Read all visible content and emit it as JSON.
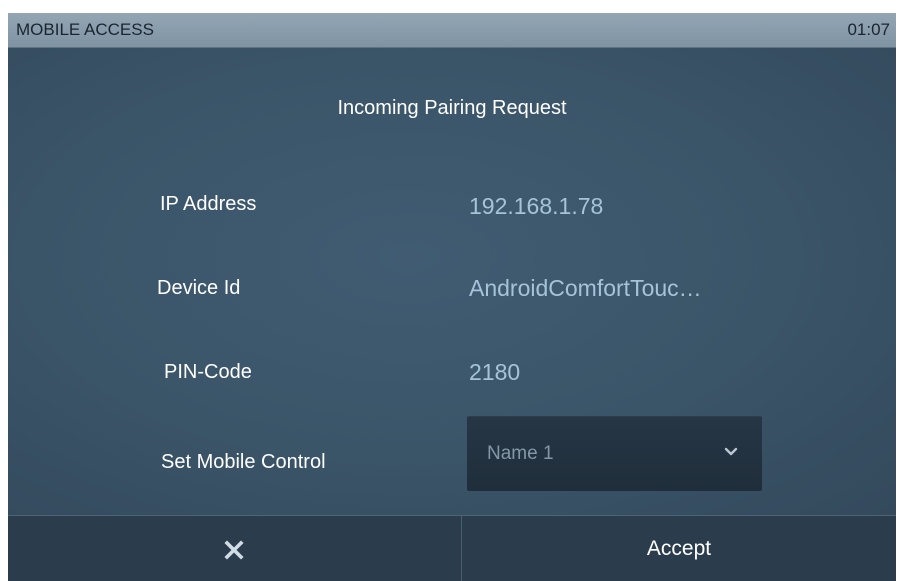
{
  "titlebar": {
    "title": "MOBILE ACCESS",
    "time": "01:07"
  },
  "dialog": {
    "title": "Incoming Pairing Request",
    "fields": {
      "ip_label": "IP Address",
      "ip_value": "192.168.1.78",
      "device_label": "Device Id",
      "device_value": "AndroidComfortTouc…",
      "pin_label": "PIN-Code",
      "pin_value": "2180",
      "control_label": "Set Mobile Control"
    },
    "control_select": {
      "selected": "Name 1",
      "icon": "chevron-down-icon"
    }
  },
  "footer": {
    "cancel_icon": "close-icon",
    "accept_label": "Accept"
  },
  "colors": {
    "background": "#3a5468",
    "titlebar": "#8a9dad",
    "value_text": "#a7c3d8",
    "footer": "#2b3d4d",
    "dropdown": "#243342"
  }
}
